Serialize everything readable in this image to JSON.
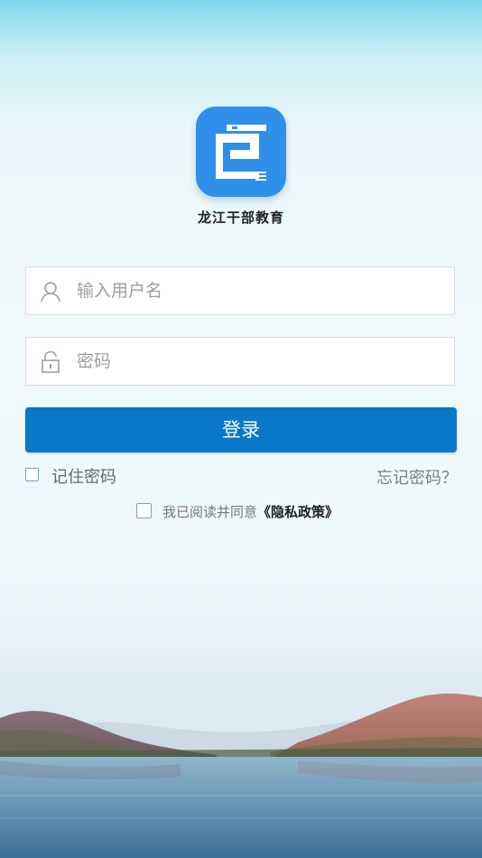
{
  "app": {
    "name": "龙江干部教育"
  },
  "login_form": {
    "username": {
      "value": "",
      "placeholder": "输入用户名",
      "icon": "user-icon"
    },
    "password": {
      "value": "",
      "placeholder": "密码",
      "icon": "lock-icon"
    },
    "submit_label": "登录"
  },
  "options": {
    "remember_password": {
      "label": "记住密码",
      "checked": false
    },
    "forgot_password_label": "忘记密码？"
  },
  "agreement": {
    "checked": false,
    "prefix": "我已阅读并同意",
    "policy_link": "《隐私政策》"
  },
  "colors": {
    "brand": "#2f90ea",
    "button": "#0a78c8",
    "checkbox_border": "#6aa4d6"
  }
}
